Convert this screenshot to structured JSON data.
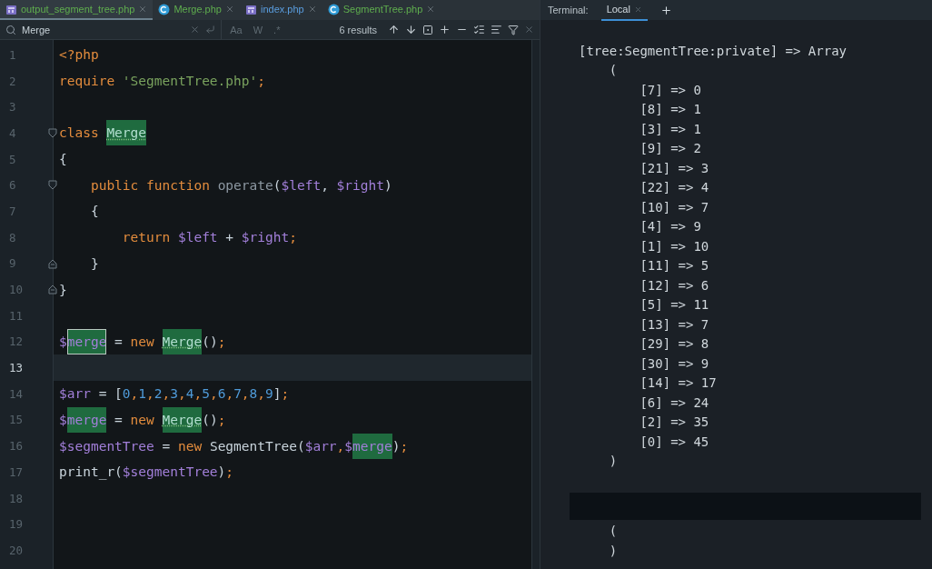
{
  "editor_tabs": [
    {
      "label": "output_segment_tree.php",
      "kind": "php",
      "selected": true,
      "color": "#5fae4e"
    },
    {
      "label": "Merge.php",
      "kind": "class",
      "selected": false,
      "color": "#5fae4e"
    },
    {
      "label": "index.php",
      "kind": "php",
      "selected": false,
      "color": "#5a9ee0"
    },
    {
      "label": "SegmentTree.php",
      "kind": "class",
      "selected": false,
      "color": "#5fae4e"
    }
  ],
  "search": {
    "value": "Merge",
    "options": [
      "Aa",
      "W",
      ".*"
    ],
    "results": "6 results"
  },
  "code_lines": [
    {
      "number": "1",
      "current": false,
      "kind": "code",
      "tokens": [
        {
          "t": "<?php",
          "kind": "keyword",
          "match": false
        }
      ]
    },
    {
      "number": "2",
      "current": false,
      "kind": "code",
      "tokens": [
        {
          "t": "require ",
          "kind": "keyword",
          "match": false
        },
        {
          "t": "'SegmentTree.php'",
          "kind": "string",
          "match": false
        },
        {
          "t": ";",
          "kind": "punct",
          "match": false
        }
      ]
    },
    {
      "number": "3",
      "current": false,
      "kind": "code"
    },
    {
      "number": "4",
      "current": false,
      "kind": "fold_start",
      "tokens": [
        {
          "t": "class ",
          "kind": "keyword",
          "match": false
        },
        {
          "t": "Merge",
          "kind": "classname",
          "match": true
        }
      ]
    },
    {
      "number": "5",
      "current": false,
      "kind": "code",
      "tokens": [
        {
          "t": "{",
          "kind": "plain",
          "match": false
        }
      ]
    },
    {
      "number": "6",
      "current": false,
      "kind": "fold_start",
      "tokens": [
        {
          "t": "    public",
          "kind": "keyword",
          "match": false
        },
        {
          "t": " function ",
          "kind": "keyword",
          "match": false
        },
        {
          "t": "operate",
          "kind": "function",
          "match": false
        },
        {
          "t": "(",
          "kind": "plain",
          "match": false
        },
        {
          "t": "$left",
          "kind": "variable",
          "match": false
        },
        {
          "t": ", ",
          "kind": "plain",
          "match": false
        },
        {
          "t": "$right",
          "kind": "variable",
          "match": false
        },
        {
          "t": ")",
          "kind": "plain",
          "match": false
        }
      ]
    },
    {
      "number": "7",
      "current": false,
      "kind": "code",
      "tokens": [
        {
          "t": "    {",
          "kind": "plain",
          "match": false
        }
      ]
    },
    {
      "number": "8",
      "current": false,
      "kind": "code",
      "tokens": [
        {
          "t": "        return ",
          "kind": "keyword",
          "match": false
        },
        {
          "t": "$left",
          "kind": "variable",
          "match": false
        },
        {
          "t": " + ",
          "kind": "plain",
          "match": false
        },
        {
          "t": "$right",
          "kind": "variable",
          "match": false
        },
        {
          "t": ";",
          "kind": "punct",
          "match": false
        }
      ]
    },
    {
      "number": "9",
      "current": false,
      "kind": "fold_end",
      "tokens": [
        {
          "t": "    }",
          "kind": "plain",
          "match": false
        }
      ]
    },
    {
      "number": "10",
      "current": false,
      "kind": "fold_end",
      "tokens": [
        {
          "t": "}",
          "kind": "plain",
          "match": false
        }
      ]
    },
    {
      "number": "11",
      "current": false,
      "kind": "code"
    },
    {
      "number": "12",
      "current": false,
      "kind": "code",
      "tokens": [
        {
          "t": "$",
          "kind": "variable",
          "match": false
        },
        {
          "t": "merge",
          "kind": "variable",
          "match": true,
          "caret": true
        },
        {
          "t": " = ",
          "kind": "plain",
          "match": false
        },
        {
          "t": "new ",
          "kind": "keyword",
          "match": false
        },
        {
          "t": "Merge",
          "kind": "classname",
          "match": true
        },
        {
          "t": "()",
          "kind": "plain",
          "match": false
        },
        {
          "t": ";",
          "kind": "punct",
          "match": false
        }
      ]
    },
    {
      "number": "13",
      "current": true,
      "kind": "code"
    },
    {
      "number": "14",
      "current": false,
      "kind": "code",
      "tokens": [
        {
          "t": "$arr",
          "kind": "variable",
          "match": false
        },
        {
          "t": " = [",
          "kind": "plain",
          "match": false
        },
        {
          "t": "0",
          "kind": "number",
          "match": false
        },
        {
          "t": ",",
          "kind": "punct",
          "match": false
        },
        {
          "t": "1",
          "kind": "number",
          "match": false
        },
        {
          "t": ",",
          "kind": "punct",
          "match": false
        },
        {
          "t": "2",
          "kind": "number",
          "match": false
        },
        {
          "t": ",",
          "kind": "punct",
          "match": false
        },
        {
          "t": "3",
          "kind": "number",
          "match": false
        },
        {
          "t": ",",
          "kind": "punct",
          "match": false
        },
        {
          "t": "4",
          "kind": "number",
          "match": false
        },
        {
          "t": ",",
          "kind": "punct",
          "match": false
        },
        {
          "t": "5",
          "kind": "number",
          "match": false
        },
        {
          "t": ",",
          "kind": "punct",
          "match": false
        },
        {
          "t": "6",
          "kind": "number",
          "match": false
        },
        {
          "t": ",",
          "kind": "punct",
          "match": false
        },
        {
          "t": "7",
          "kind": "number",
          "match": false
        },
        {
          "t": ",",
          "kind": "punct",
          "match": false
        },
        {
          "t": "8",
          "kind": "number",
          "match": false
        },
        {
          "t": ",",
          "kind": "punct",
          "match": false
        },
        {
          "t": "9",
          "kind": "number",
          "match": false
        },
        {
          "t": "]",
          "kind": "plain",
          "match": false
        },
        {
          "t": ";",
          "kind": "punct",
          "match": false
        }
      ]
    },
    {
      "number": "15",
      "current": false,
      "kind": "code",
      "tokens": [
        {
          "t": "$",
          "kind": "variable",
          "match": false
        },
        {
          "t": "merge",
          "kind": "variable",
          "match": true
        },
        {
          "t": " = ",
          "kind": "plain",
          "match": false
        },
        {
          "t": "new ",
          "kind": "keyword",
          "match": false
        },
        {
          "t": "Merge",
          "kind": "classname",
          "match": true
        },
        {
          "t": "()",
          "kind": "plain",
          "match": false
        },
        {
          "t": ";",
          "kind": "punct",
          "match": false
        }
      ]
    },
    {
      "number": "16",
      "current": false,
      "kind": "code",
      "tokens": [
        {
          "t": "$segmentTree",
          "kind": "variable",
          "match": false
        },
        {
          "t": " = ",
          "kind": "plain",
          "match": false
        },
        {
          "t": "new",
          "kind": "keyword",
          "match": false
        },
        {
          "t": " SegmentTree(",
          "kind": "plain",
          "match": false
        },
        {
          "t": "$arr",
          "kind": "variable",
          "match": false
        },
        {
          "t": ",",
          "kind": "punct",
          "match": false
        },
        {
          "t": "$",
          "kind": "variable",
          "match": false
        },
        {
          "t": "merge",
          "kind": "variable",
          "match": true
        },
        {
          "t": ")",
          "kind": "plain",
          "match": false
        },
        {
          "t": ";",
          "kind": "punct",
          "match": false
        }
      ]
    },
    {
      "number": "17",
      "current": false,
      "kind": "code",
      "tokens": [
        {
          "t": "print_r(",
          "kind": "plain",
          "match": false
        },
        {
          "t": "$segmentTree",
          "kind": "variable",
          "match": false
        },
        {
          "t": ")",
          "kind": "plain",
          "match": false
        },
        {
          "t": ";",
          "kind": "punct",
          "match": false
        }
      ]
    },
    {
      "number": "18",
      "current": false,
      "kind": "code"
    },
    {
      "number": "19",
      "current": false,
      "kind": "code"
    },
    {
      "number": "20",
      "current": false,
      "kind": "code"
    }
  ],
  "terminal": {
    "label": "Terminal:",
    "tabs": [
      {
        "label": "Local",
        "selected": true
      }
    ],
    "lines": [
      {
        "kind": "output",
        "text": "[tree:SegmentTree:private] => Array"
      },
      {
        "kind": "output",
        "text": "    ("
      },
      {
        "kind": "output",
        "text": "        [7] => 0"
      },
      {
        "kind": "output",
        "text": "        [8] => 1"
      },
      {
        "kind": "output",
        "text": "        [3] => 1"
      },
      {
        "kind": "output",
        "text": "        [9] => 2"
      },
      {
        "kind": "output",
        "text": "        [21] => 3"
      },
      {
        "kind": "output",
        "text": "        [22] => 4"
      },
      {
        "kind": "output",
        "text": "        [10] => 7"
      },
      {
        "kind": "output",
        "text": "        [4] => 9"
      },
      {
        "kind": "output",
        "text": "        [1] => 10"
      },
      {
        "kind": "output",
        "text": "        [11] => 5"
      },
      {
        "kind": "output",
        "text": "        [12] => 6"
      },
      {
        "kind": "output",
        "text": "        [5] => 11"
      },
      {
        "kind": "output",
        "text": "        [13] => 7"
      },
      {
        "kind": "output",
        "text": "        [29] => 8"
      },
      {
        "kind": "output",
        "text": "        [30] => 9"
      },
      {
        "kind": "output",
        "text": "        [14] => 17"
      },
      {
        "kind": "output",
        "text": "        [6] => 24"
      },
      {
        "kind": "output",
        "text": "        [2] => 35"
      },
      {
        "kind": "output",
        "text": "        [0] => 45"
      },
      {
        "kind": "output",
        "text": "    )"
      },
      {
        "kind": "blank"
      },
      {
        "kind": "redacted"
      },
      {
        "kind": "output",
        "text": "    ("
      },
      {
        "kind": "output",
        "text": "    )"
      }
    ]
  }
}
